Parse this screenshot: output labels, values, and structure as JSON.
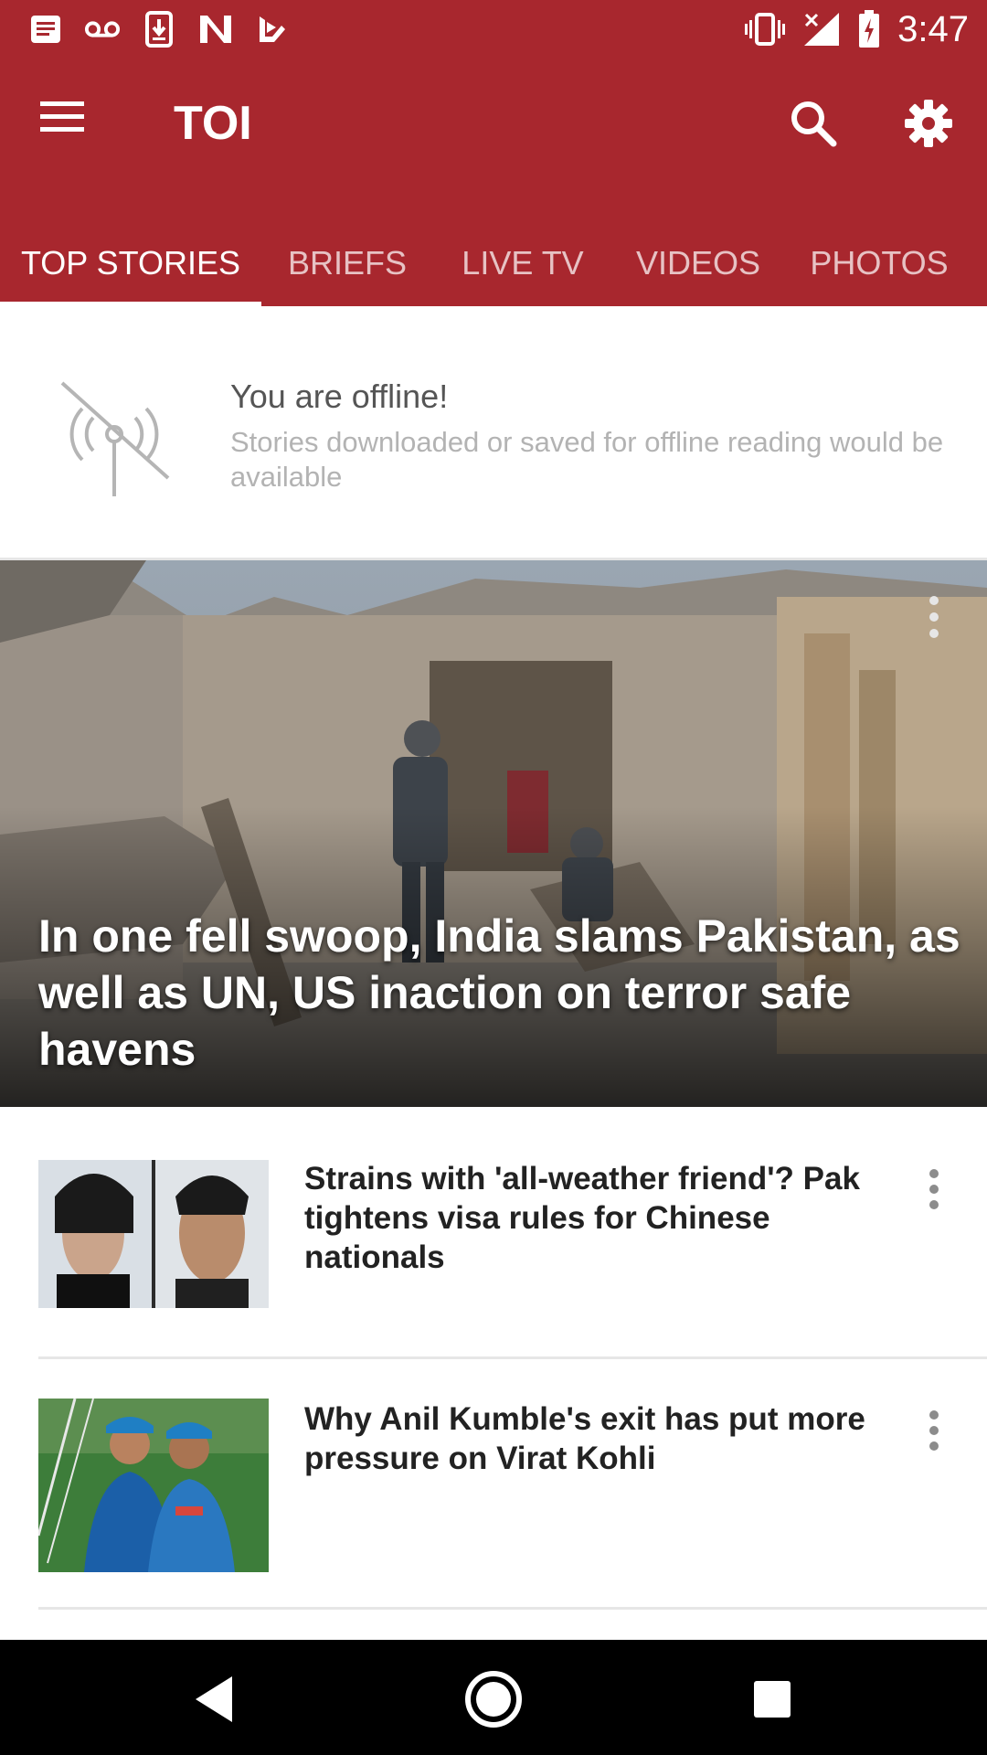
{
  "status_bar": {
    "time": "3:47",
    "left_icons": [
      "messages-icon",
      "voicemail-icon",
      "download-icon",
      "n-app-icon",
      "play-store-icon"
    ],
    "right_icons": [
      "vibrate-icon",
      "no-signal-icon",
      "battery-charging-icon"
    ]
  },
  "app_bar": {
    "title": "TOI",
    "color": "#a8272e"
  },
  "tabs": [
    {
      "label": "TOP STORIES",
      "active": true
    },
    {
      "label": "BRIEFS",
      "active": false
    },
    {
      "label": "LIVE TV",
      "active": false
    },
    {
      "label": "VIDEOS",
      "active": false
    },
    {
      "label": "PHOTOS",
      "active": false
    }
  ],
  "offline": {
    "title": "You are offline!",
    "message": "Stories downloaded or saved for offline reading would be available"
  },
  "hero": {
    "headline": "In one fell swoop, India slams Pakistan, as well as UN, US inaction on terror safe havens"
  },
  "stories": [
    {
      "title": "Strains with 'all-weather friend'? Pak tightens visa rules for Chinese nationals"
    },
    {
      "title": "Why Anil Kumble's exit has put more pressure on Virat Kohli"
    }
  ]
}
